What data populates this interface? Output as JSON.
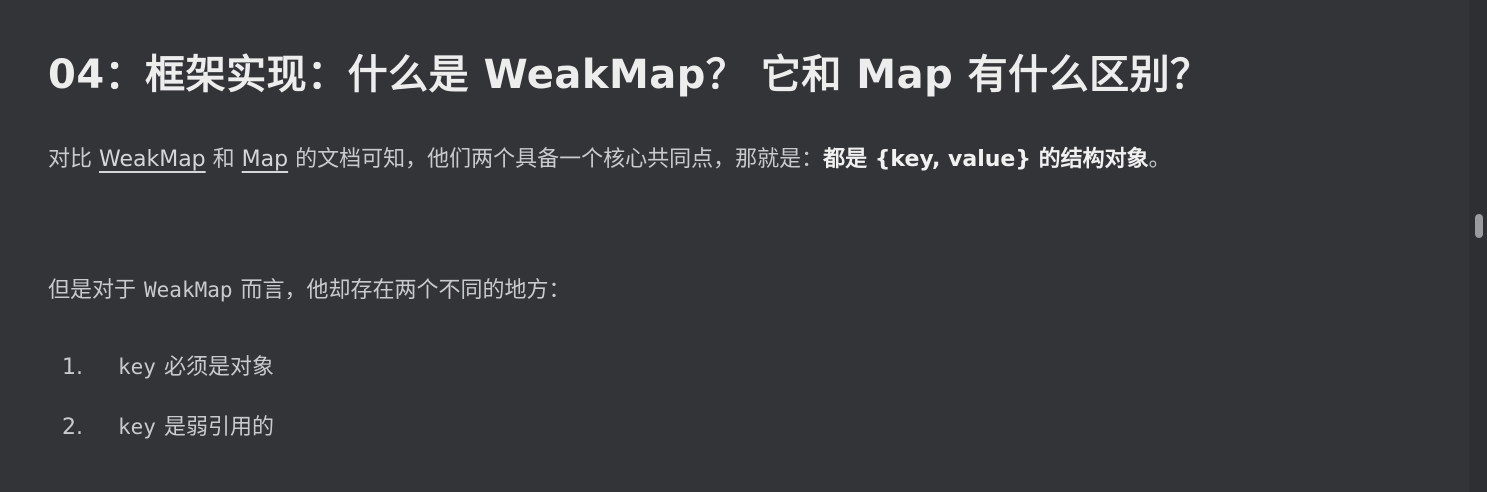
{
  "heading": "04：框架实现：什么是 WeakMap？ 它和 Map 有什么区别？",
  "paragraph1": {
    "prefix": "对比 ",
    "link1": "WeakMap",
    "connector": " 和 ",
    "link2": "Map",
    "middle": " 的文档可知，他们两个具备一个核心共同点，那就是：",
    "bold": "都是 {key, value} 的结构对象",
    "suffix": "。"
  },
  "paragraph2": {
    "prefix": "但是对于",
    "code": "WeakMap",
    "suffix": "而言，他却存在两个不同的地方："
  },
  "list": [
    {
      "num": "1.",
      "code": "key",
      "text": "必须是对象"
    },
    {
      "num": "2.",
      "code": "key",
      "text": "是弱引用的"
    }
  ]
}
